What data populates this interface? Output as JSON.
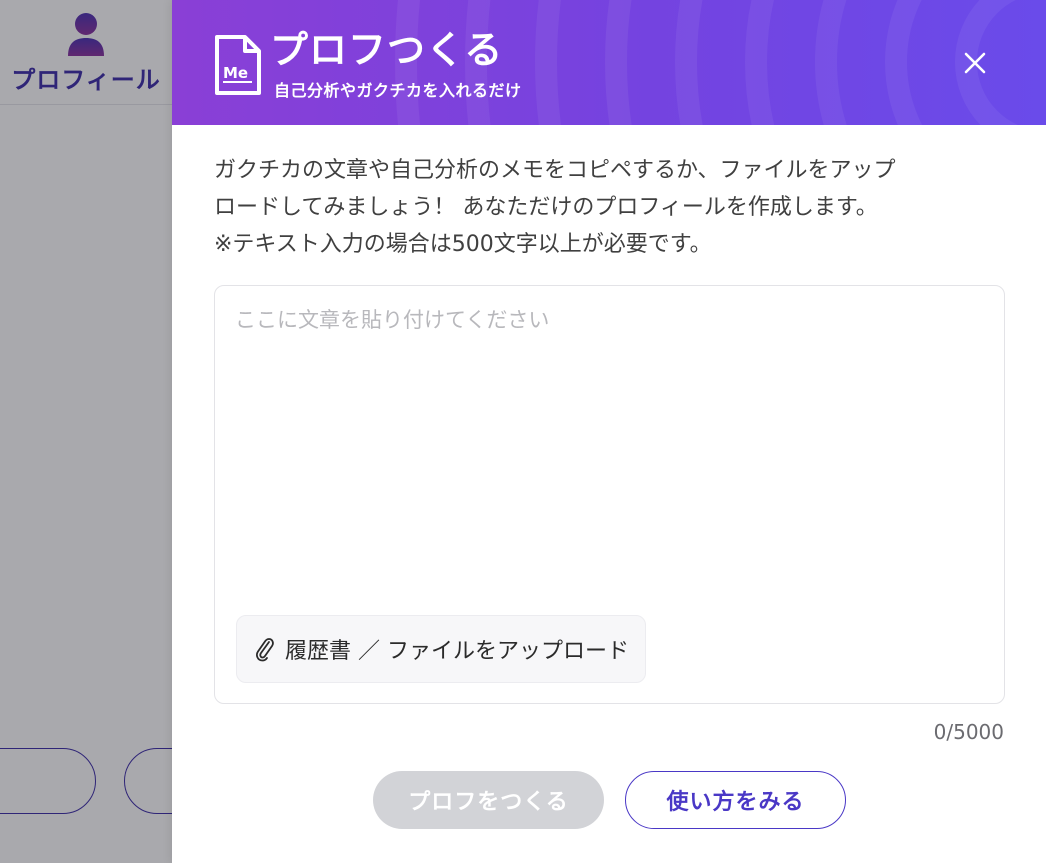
{
  "background": {
    "profile_label": "プロフィール"
  },
  "modal": {
    "title": "プロフつくる",
    "subtitle": "自己分析やガクチカを入れるだけ",
    "logo_text": "Me",
    "description": [
      "ガクチカの文章や自己分析のメモをコピペするか、ファイルをアップ",
      "ロードしてみましょう！ あなただけのプロフィールを作成します。",
      "※テキスト入力の場合は500文字以上が必要です。"
    ],
    "input": {
      "placeholder": "ここに文章を貼り付けてください",
      "value": ""
    },
    "upload_label": "履歴書 ／ ファイルをアップロード",
    "char_count": "0/5000",
    "create_button": "プロフをつくる",
    "howto_button": "使い方をみる"
  },
  "colors": {
    "header_gradient_start": "#8a3fd6",
    "header_gradient_end": "#6a4bea",
    "accent": "#4a38c6",
    "disabled_button": "#d2d3d7"
  },
  "icons": [
    "user-icon",
    "document-me-icon",
    "close-icon",
    "paperclip-icon"
  ]
}
